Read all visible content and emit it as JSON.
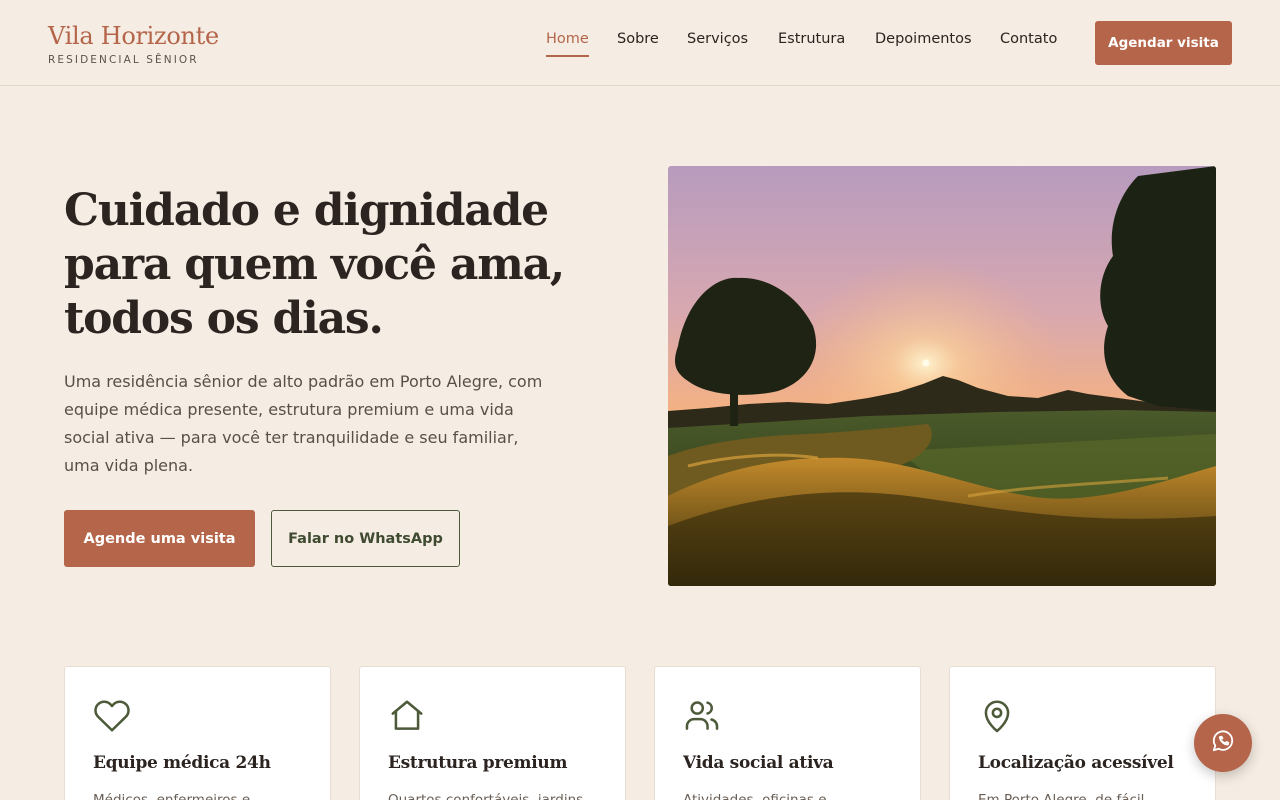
{
  "brand": {
    "name": "Vila Horizonte",
    "subtitle": "RESIDENCIAL SÊNIOR"
  },
  "nav": {
    "items": [
      {
        "label": "Home",
        "active": true
      },
      {
        "label": "Sobre",
        "active": false
      },
      {
        "label": "Serviços",
        "active": false
      },
      {
        "label": "Estrutura",
        "active": false
      },
      {
        "label": "Depoimentos",
        "active": false
      },
      {
        "label": "Contato",
        "active": false
      }
    ],
    "cta": "Agendar visita"
  },
  "hero": {
    "title": "Cuidado e dignidade para quem você ama, todos os dias.",
    "text": "Uma residência sênior de alto padrão em Porto Alegre, com equipe médica presente, estrutura premium e uma vida social ativa — para você ter tranquilidade e seu familiar, uma vida plena.",
    "primary_button": "Agende uma visita",
    "secondary_button": "Falar no WhatsApp",
    "image": "sunset-garden-photo"
  },
  "features": [
    {
      "icon": "heart-icon",
      "title": "Equipe médica 24h",
      "text": "Médicos, enfermeiros e"
    },
    {
      "icon": "home-icon",
      "title": "Estrutura premium",
      "text": "Quartos confortáveis, jardins"
    },
    {
      "icon": "users-icon",
      "title": "Vida social ativa",
      "text": "Atividades, oficinas e"
    },
    {
      "icon": "map-pin-icon",
      "title": "Localização acessível",
      "text": "Em Porto Alegre, de fácil"
    }
  ],
  "floating_button": {
    "icon": "whatsapp-icon"
  },
  "colors": {
    "background": "#f5ede3",
    "accent": "#b4654a",
    "olive": "#4d5a3a",
    "text": "#2b2420"
  }
}
